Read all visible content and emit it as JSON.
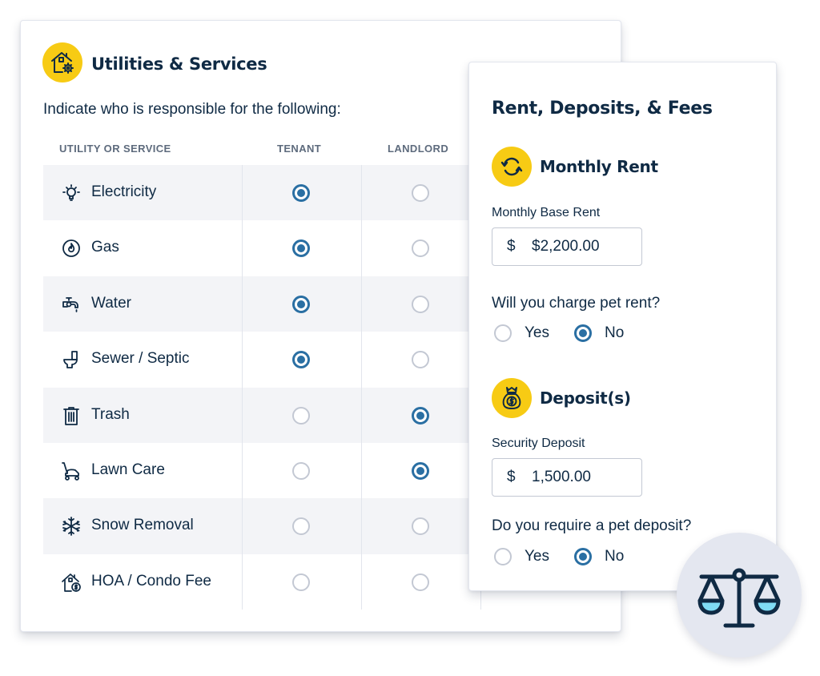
{
  "utilities": {
    "title": "Utilities & Services",
    "title_icon": "house-gear-icon",
    "instruction": "Indicate who is responsible for the following:",
    "columns": [
      "UTILITY OR SERVICE",
      "TENANT",
      "LANDLORD"
    ],
    "rows": [
      {
        "label": "Electricity",
        "icon": "lightbulb-icon",
        "responsible": "tenant"
      },
      {
        "label": "Gas",
        "icon": "flame-icon",
        "responsible": "tenant"
      },
      {
        "label": "Water",
        "icon": "faucet-icon",
        "responsible": "tenant"
      },
      {
        "label": "Sewer / Septic",
        "icon": "toilet-icon",
        "responsible": "tenant"
      },
      {
        "label": "Trash",
        "icon": "trash-can-icon",
        "responsible": "landlord"
      },
      {
        "label": "Lawn Care",
        "icon": "lawn-mower-icon",
        "responsible": "landlord"
      },
      {
        "label": "Snow Removal",
        "icon": "snowflake-icon",
        "responsible": "none"
      },
      {
        "label": "HOA / Condo Fee",
        "icon": "house-dollar-icon",
        "responsible": "none"
      }
    ]
  },
  "rent": {
    "title": "Rent, Deposits, & Fees",
    "monthly": {
      "heading": "Monthly Rent",
      "icon": "recurring-arrows-icon",
      "base_rent_label": "Monthly Base Rent",
      "currency_symbol": "$",
      "base_rent_value": "$2,200.00",
      "pet_rent_question": "Will you charge pet rent?",
      "yes_label": "Yes",
      "no_label": "No",
      "pet_rent_answer": "no"
    },
    "deposits": {
      "heading": "Deposit(s)",
      "icon": "money-bag-icon",
      "security_label": "Security Deposit",
      "currency_symbol": "$",
      "security_value": "1,500.00",
      "pet_deposit_question": "Do you require a pet deposit?",
      "yes_label": "Yes",
      "no_label": "No",
      "pet_deposit_answer": "no"
    }
  },
  "badge": {
    "icon": "scales-of-justice-icon"
  },
  "colors": {
    "accent": "#2a6fa3",
    "badge_yellow": "#f7cb14",
    "text": "#0f2a44",
    "stripe": "#f3f4f7"
  }
}
